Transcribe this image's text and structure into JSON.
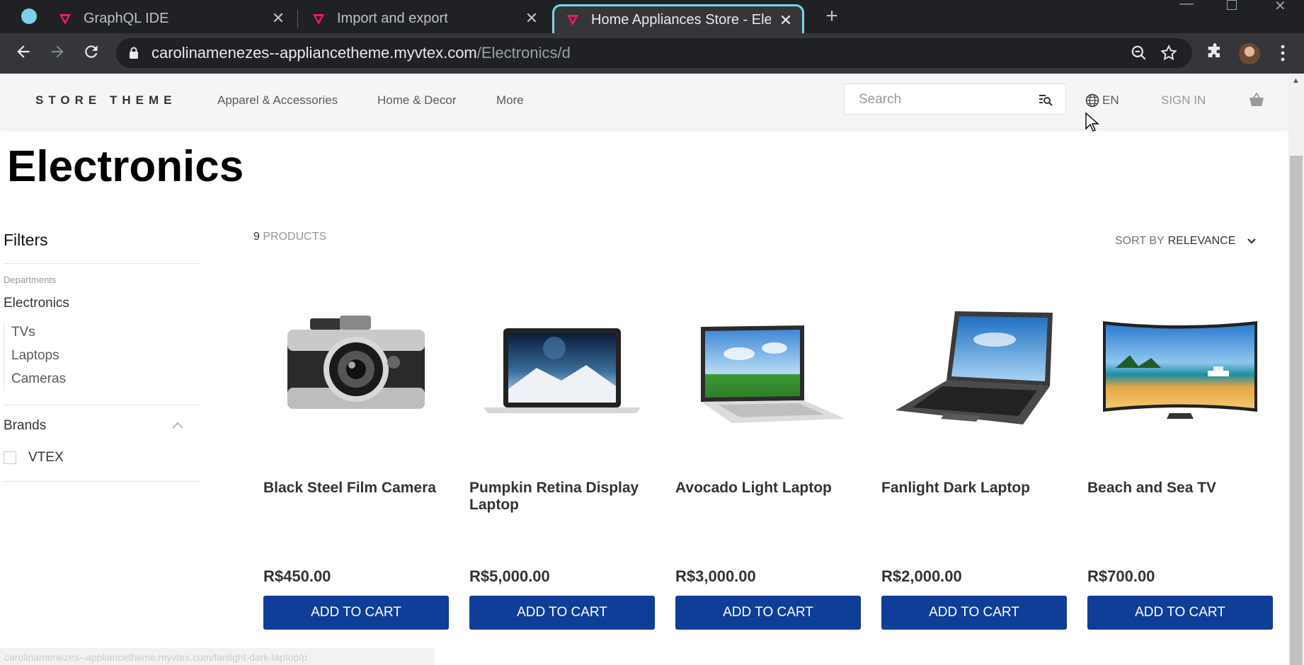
{
  "browser": {
    "tabs": [
      {
        "title": "GraphQL IDE"
      },
      {
        "title": "Import and export"
      },
      {
        "title": "Home Appliances Store - Electronics"
      }
    ],
    "url_host": "carolinamenezes--appliancetheme.myvtex.com",
    "url_path": "/Electronics/d",
    "status_url": "carolinamenezes--appliancetheme.myvtex.com/fanlight-dark-laptop/p"
  },
  "store": {
    "logo": "STORE THEME",
    "menu": [
      "Apparel & Accessories",
      "Home & Decor",
      "More"
    ],
    "search_placeholder": "Search",
    "language": "EN",
    "signin": "SIGN IN"
  },
  "page": {
    "title": "Electronics"
  },
  "filters": {
    "title": "Filters",
    "departments_label": "Departments",
    "current_department": "Electronics",
    "subcategories": [
      "TVs",
      "Laptops",
      "Cameras"
    ],
    "brands_title": "Brands",
    "brands": [
      {
        "label": "VTEX",
        "checked": false
      }
    ]
  },
  "results": {
    "count": "9",
    "count_label": "PRODUCTS",
    "sort_label": "SORT BY",
    "sort_value": "RELEVANCE"
  },
  "products": [
    {
      "name": "Black Steel Film Camera",
      "price": "R$450.00",
      "button": "ADD TO CART"
    },
    {
      "name": "Pumpkin Retina Display Laptop",
      "price": "R$5,000.00",
      "button": "ADD TO CART"
    },
    {
      "name": "Avocado Light Laptop",
      "price": "R$3,000.00",
      "button": "ADD TO CART"
    },
    {
      "name": "Fanlight Dark Laptop",
      "price": "R$2,000.00",
      "button": "ADD TO CART"
    },
    {
      "name": "Beach and Sea TV",
      "price": "R$700.00",
      "button": "ADD TO CART"
    }
  ],
  "colors": {
    "accent_blue": "#0f3e99",
    "tab_highlight": "#7ad3e8",
    "vtex_pink": "#f71963"
  }
}
